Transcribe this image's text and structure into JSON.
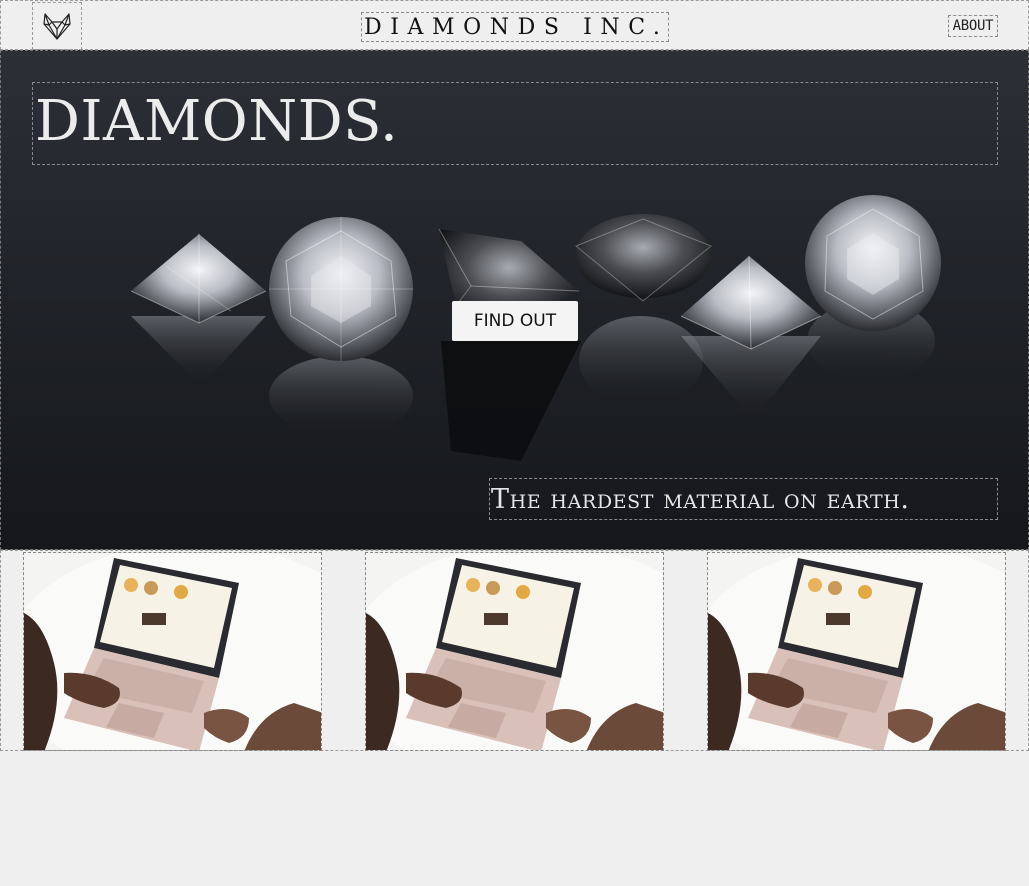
{
  "header": {
    "logo_icon": "fox-logo-icon",
    "brand": "DIAMONDS INC.",
    "about_label": "ABOUT"
  },
  "hero": {
    "title": "DIAMONDS.",
    "button_label": "FIND OUT",
    "tagline": "The hardest material on earth."
  },
  "cards": [
    {
      "image": "laptop-on-table-photo"
    },
    {
      "image": "laptop-on-table-photo"
    },
    {
      "image": "laptop-on-table-photo"
    }
  ],
  "colors": {
    "page_bg": "#efefef",
    "hero_bg": "#22252b",
    "hero_text": "#ececec",
    "button_bg": "#f4f4f4"
  }
}
